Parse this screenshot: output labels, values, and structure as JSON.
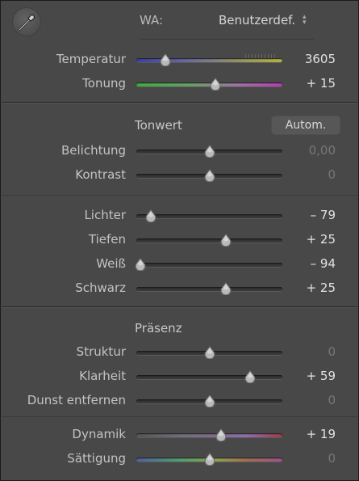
{
  "wb": {
    "label": "WA:",
    "preset": "Benutzerdef.",
    "temperature": {
      "label": "Temperatur",
      "value": "3605",
      "position": 0.2
    },
    "tint": {
      "label": "Tonung",
      "value": "+ 15",
      "position": 0.54
    }
  },
  "tone": {
    "title": "Tonwert",
    "auto_label": "Autom.",
    "exposure": {
      "label": "Belichtung",
      "value": "0,00",
      "position": 0.5
    },
    "contrast": {
      "label": "Kontrast",
      "value": "0",
      "position": 0.5
    },
    "highlights": {
      "label": "Lichter",
      "value": "– 79",
      "position": 0.1
    },
    "shadows": {
      "label": "Tiefen",
      "value": "+ 25",
      "position": 0.615
    },
    "whites": {
      "label": "Weiß",
      "value": "– 94",
      "position": 0.03
    },
    "blacks": {
      "label": "Schwarz",
      "value": "+ 25",
      "position": 0.615
    }
  },
  "presence": {
    "title": "Präsenz",
    "texture": {
      "label": "Struktur",
      "value": "0",
      "position": 0.5
    },
    "clarity": {
      "label": "Klarheit",
      "value": "+ 59",
      "position": 0.78
    },
    "dehaze": {
      "label": "Dunst entfernen",
      "value": "0",
      "position": 0.5
    },
    "vibrance": {
      "label": "Dynamik",
      "value": "+ 19",
      "position": 0.58
    },
    "saturation": {
      "label": "Sättigung",
      "value": "0",
      "position": 0.5
    }
  },
  "icons": {
    "eyedropper": "eyedropper-icon",
    "select_arrows": "updown-arrows-icon",
    "slider_thumb": "slider-thumb-icon"
  }
}
